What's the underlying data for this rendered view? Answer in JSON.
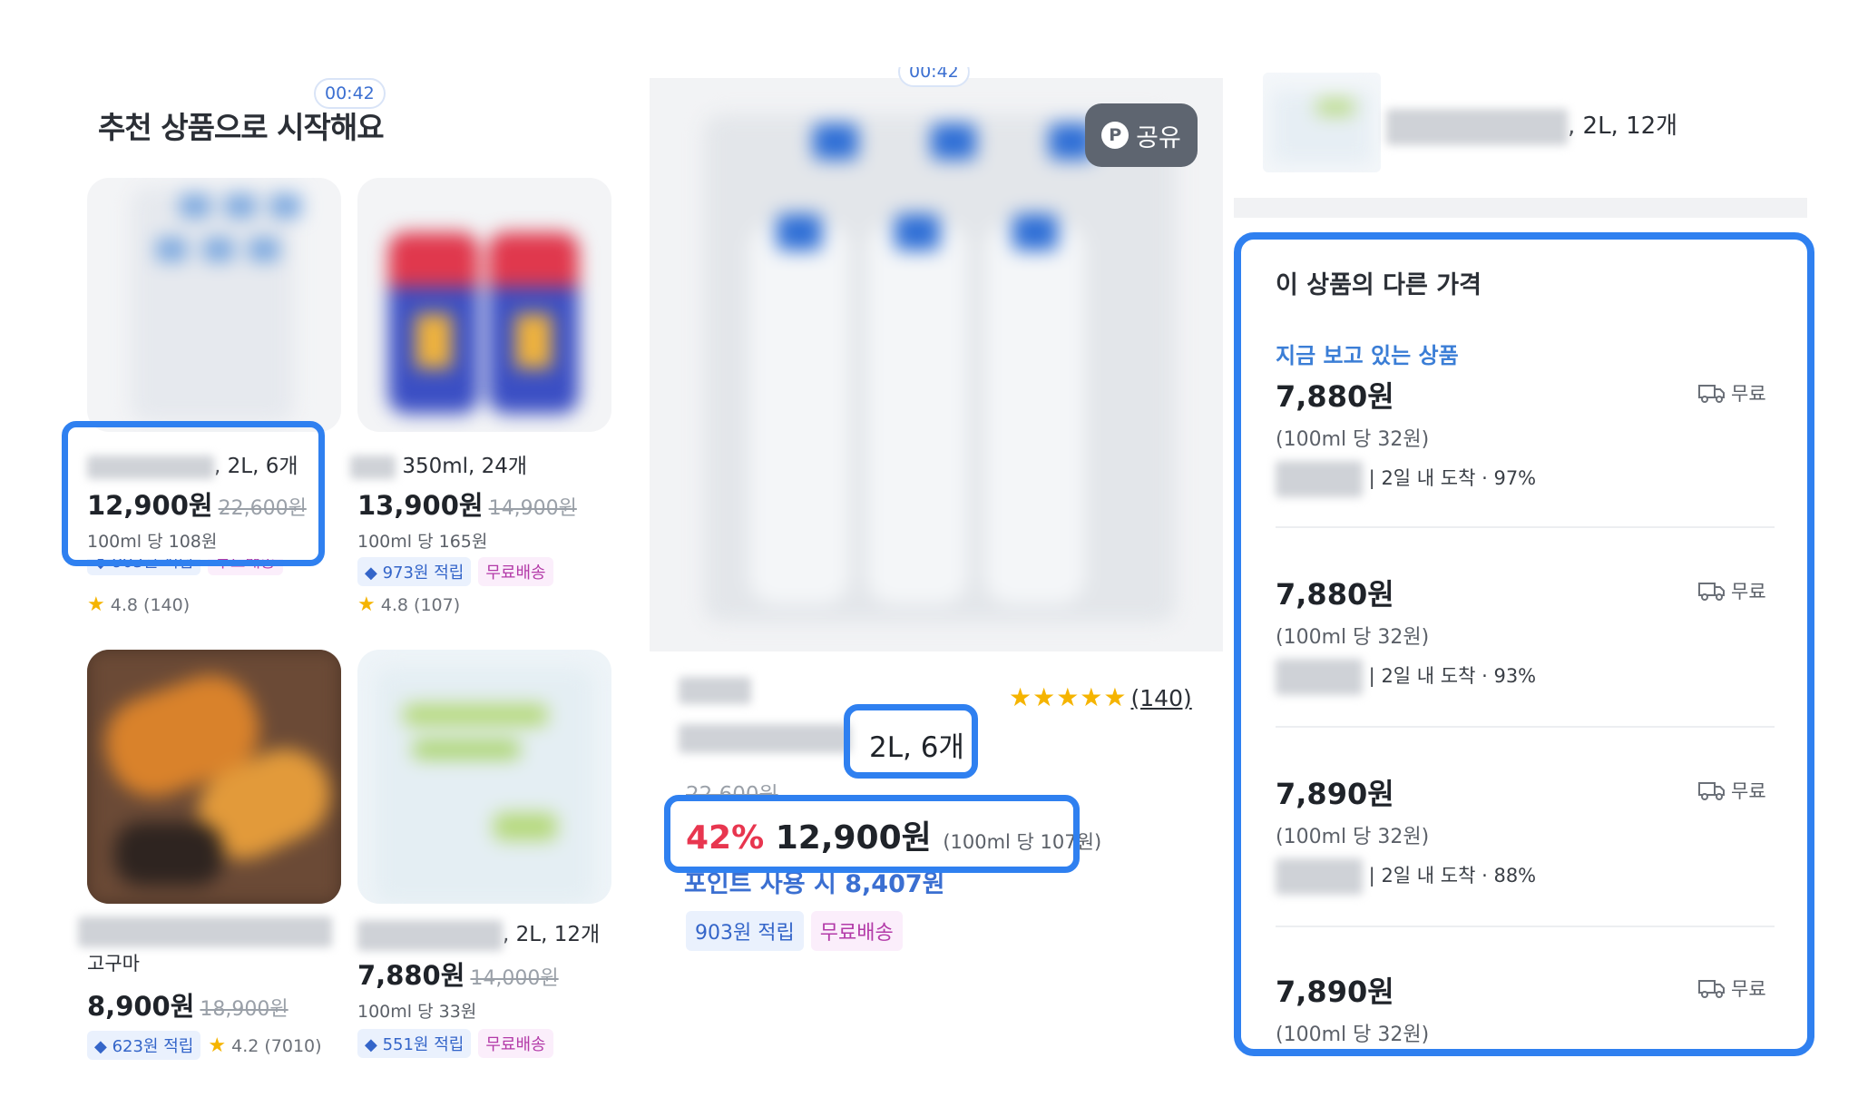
{
  "timer": "00:42",
  "recommend": {
    "title": "추천 상품으로 시작해요",
    "products": [
      {
        "name_suffix": ", 2L, 6개",
        "price": "12,900원",
        "original": "22,600원",
        "unit_price": "100ml 당 108원",
        "points": "903원 적립",
        "shipping": "무료배송",
        "rating": "4.8 (140)"
      },
      {
        "name_suffix": "350ml, 24개",
        "price": "13,900원",
        "original": "14,900원",
        "unit_price": "100ml 당 165원",
        "points": "973원 적립",
        "shipping": "무료배송",
        "rating": "4.8 (107)"
      },
      {
        "name": "고구마",
        "price": "8,900원",
        "original": "18,900원",
        "points": "623원 적립",
        "rating": "4.2 (7010)"
      },
      {
        "name_suffix": ", 2L, 12개",
        "price": "7,880원",
        "original": "14,000원",
        "unit_price": "100ml 당 33원",
        "points": "551원 적립",
        "shipping": "무료배송"
      }
    ]
  },
  "detail": {
    "share_label": "공유",
    "share_badge": "P",
    "rating_count": "(140)",
    "option": "2L, 6개",
    "old_price": "22,600원",
    "discount": "42%",
    "price": "12,900원",
    "unit_price": "(100ml 당 107원)",
    "point_price": "포인트 사용 시 8,407원",
    "points": "903원 적립",
    "shipping": "무료배송"
  },
  "other": {
    "top_name_suffix": ", 2L, 12개",
    "title": "이 상품의 다른 가격",
    "now_viewing": "지금 보고 있는 상품",
    "offers": [
      {
        "price": "7,880원",
        "unit": "(100ml 당 32원)",
        "meta": "2일 내 도착 · 97%",
        "ship": "무료"
      },
      {
        "price": "7,880원",
        "unit": "(100ml 당 32원)",
        "meta": "2일 내 도착 · 93%",
        "ship": "무료"
      },
      {
        "price": "7,890원",
        "unit": "(100ml 당 32원)",
        "meta": "2일 내 도착 · 88%",
        "ship": "무료"
      },
      {
        "price": "7,890원",
        "unit": "(100ml 당 32원)",
        "ship": "무료"
      }
    ]
  },
  "colors": {
    "highlight": "#2f80f0",
    "discount": "#e8364f",
    "link": "#3b7ed6"
  }
}
